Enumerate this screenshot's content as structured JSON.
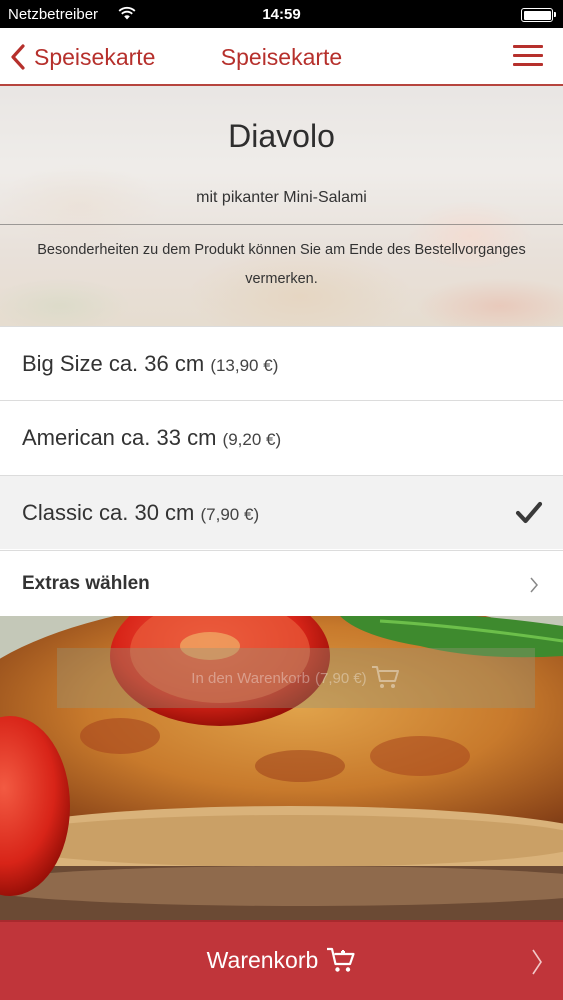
{
  "status_bar": {
    "carrier": "Netzbetreiber",
    "time": "14:59",
    "battery_level": 1.0
  },
  "nav": {
    "back_label": "Speisekarte",
    "title": "Speisekarte",
    "accent_color": "#b6302c"
  },
  "product": {
    "name": "Diavolo",
    "description": "mit pikanter Mini-Salami",
    "note": "Besonderheiten zu dem Produkt können Sie am Ende des Bestellvorganges vermerken."
  },
  "sizes": [
    {
      "label": "Big Size ca. 36 cm",
      "price": "(13,90 €)",
      "selected": false
    },
    {
      "label": "American ca. 33 cm",
      "price": "(9,20 €)",
      "selected": false
    },
    {
      "label": "Classic ca. 30 cm",
      "price": "(7,90 €)",
      "selected": true
    }
  ],
  "extras": {
    "label": "Extras wählen",
    "icon": "chevron-right-icon"
  },
  "add_to_cart": {
    "label": "In den Warenkorb",
    "price": "(7,90 €)",
    "icon": "cart-icon"
  },
  "cart_bar": {
    "label": "Warenkorb",
    "icon": "cart-icon",
    "color": "#c0353a"
  }
}
